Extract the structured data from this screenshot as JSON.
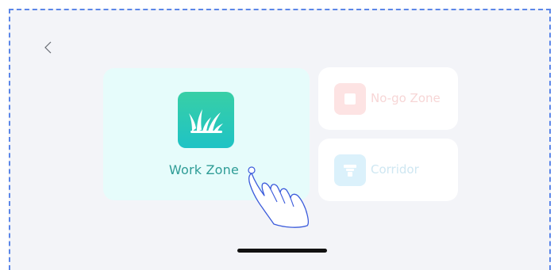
{
  "nav": {
    "back_icon": "chevron-left-icon"
  },
  "zones": {
    "work": {
      "label": "Work Zone",
      "icon": "grass-icon",
      "color": "#2e9c96"
    },
    "nogo": {
      "label": "No-go Zone",
      "icon": "square-icon",
      "color": "#f7d6d6"
    },
    "corridor": {
      "label": "Corridor",
      "icon": "corridor-icon",
      "color": "#cfe7f2"
    }
  },
  "hint": {
    "icon": "tap-hand-icon"
  }
}
